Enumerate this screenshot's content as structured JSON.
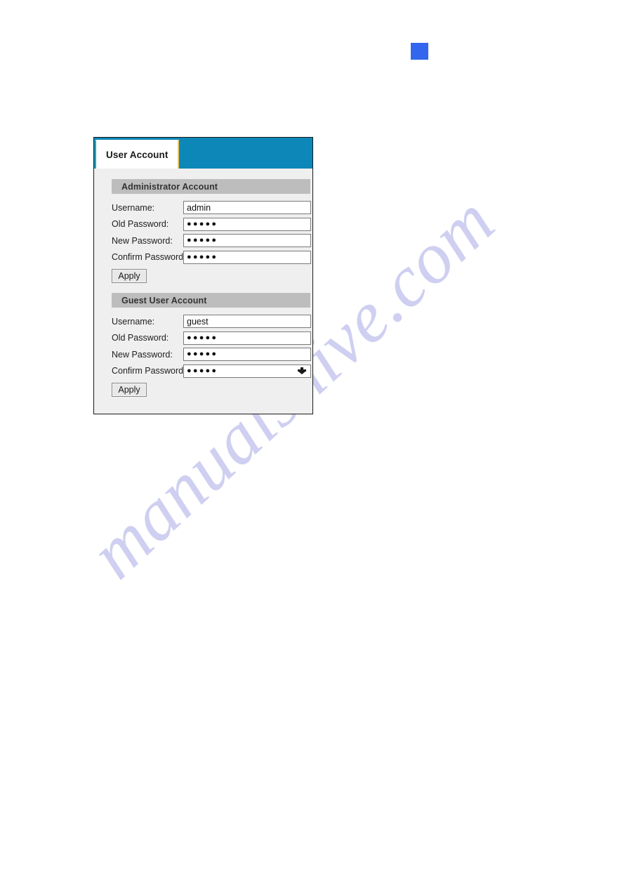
{
  "page": {
    "watermark": "manualshive.com",
    "marker_color": "#3366ee"
  },
  "panel": {
    "tabs": [
      {
        "label": "User Account",
        "active": true
      }
    ],
    "sections": [
      {
        "id": "administrator",
        "header": "Administrator Account",
        "fields": [
          {
            "label": "Username:",
            "value": "admin",
            "type": "text"
          },
          {
            "label": "Old Password:",
            "value": "●●●●●",
            "type": "password"
          },
          {
            "label": "New Password:",
            "value": "●●●●●",
            "type": "password"
          },
          {
            "label": "Confirm Password:",
            "value": "●●●●●",
            "type": "password"
          }
        ],
        "apply_label": "Apply"
      },
      {
        "id": "guest",
        "header": "Guest User Account",
        "fields": [
          {
            "label": "Username:",
            "value": "guest",
            "type": "text"
          },
          {
            "label": "Old Password:",
            "value": "●●●●●",
            "type": "password"
          },
          {
            "label": "New Password:",
            "value": "●●●●●",
            "type": "password"
          },
          {
            "label": "Confirm Password:",
            "value": "●●●●●",
            "type": "password"
          }
        ],
        "apply_label": "Apply"
      }
    ],
    "colors": {
      "tab_bar": "#0c87b8",
      "section_header": "#bdbdbd",
      "body": "#efefef"
    }
  }
}
